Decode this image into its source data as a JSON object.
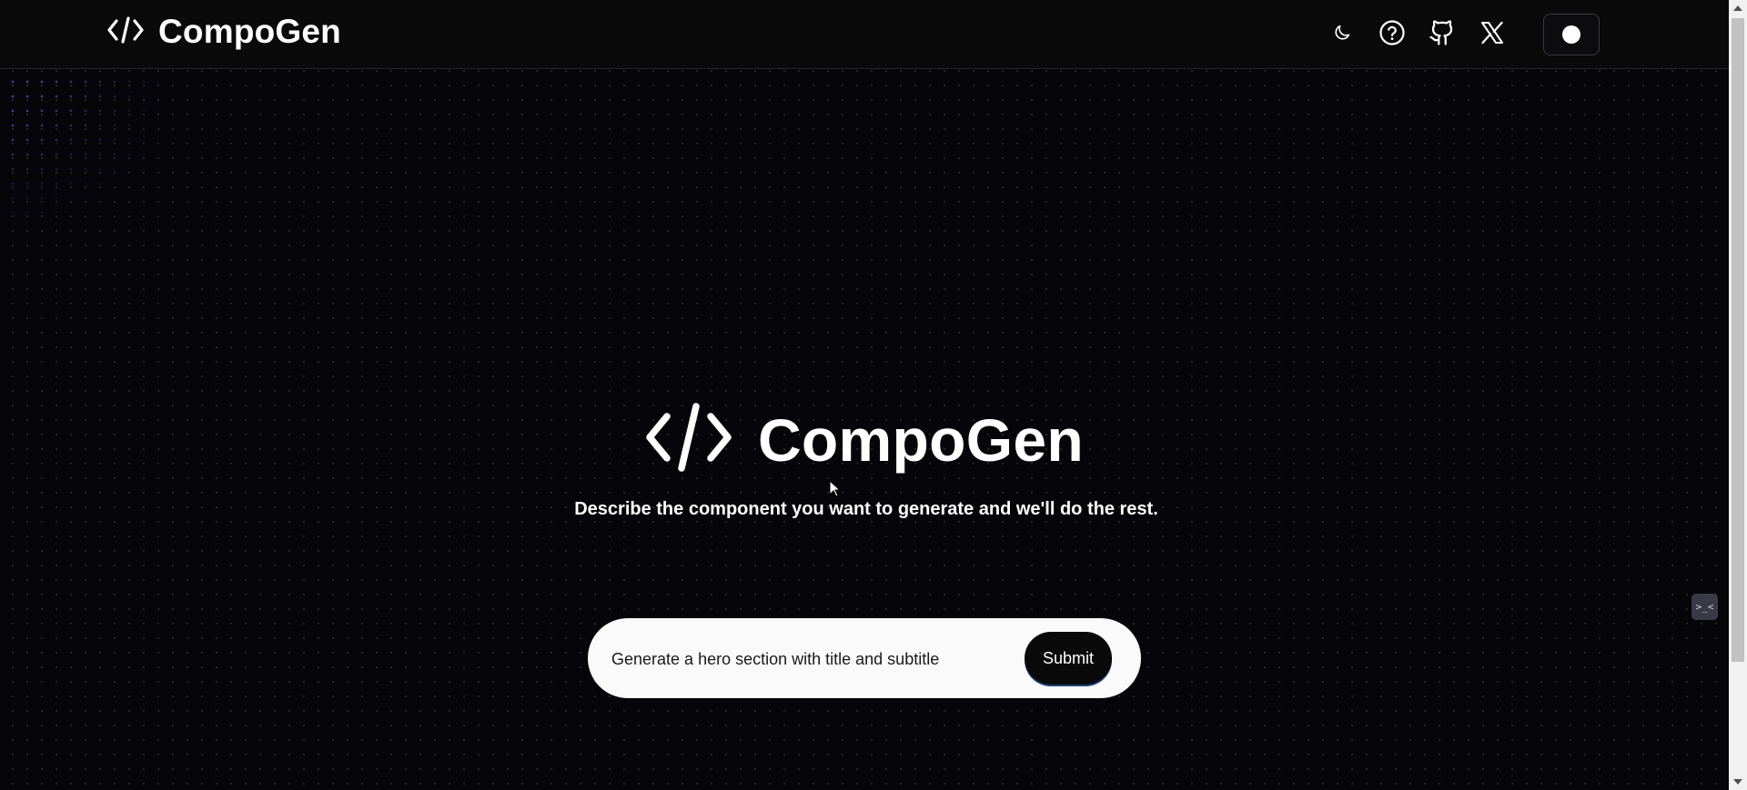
{
  "header": {
    "brand": "CompoGen",
    "logo_icon": "code-brackets-icon",
    "icons": [
      "moon-icon",
      "help-circle-icon",
      "github-icon",
      "x-twitter-icon",
      "record-dot-icon"
    ]
  },
  "hero": {
    "title": "CompoGen",
    "logo_icon": "code-brackets-icon",
    "subtitle": "Describe the component you want to generate and we'll do the rest."
  },
  "prompt": {
    "value": "Generate a hero section with title and subtitle",
    "submit_label": "Submit"
  },
  "widget": {
    "label": ">_<"
  },
  "colors": {
    "background": "#05050a",
    "header": "#0a0a0b",
    "input_bg": "#fafafa",
    "button": "#0a0a0a",
    "dot_glow": "#6e6eff"
  }
}
